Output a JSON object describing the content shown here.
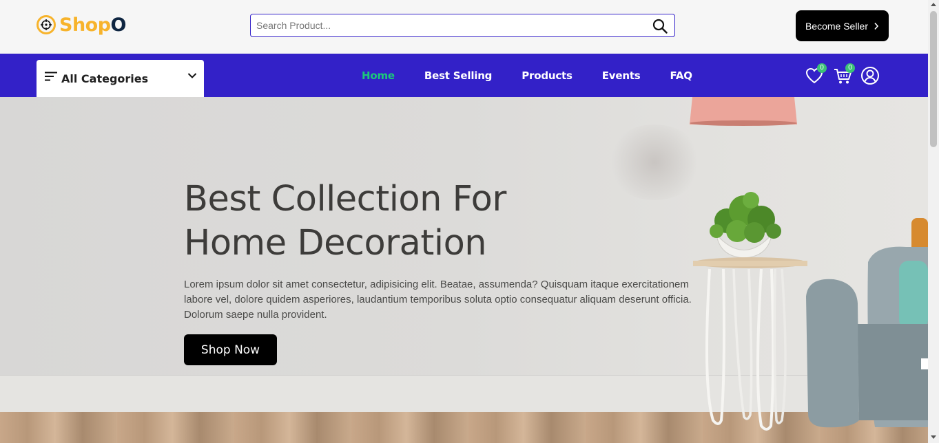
{
  "header": {
    "logo": {
      "part1": "Shop",
      "part2": "O"
    },
    "search": {
      "placeholder": "Search Product..."
    },
    "seller_button": "Become Seller"
  },
  "nav": {
    "categories_label": "All Categories",
    "links": [
      {
        "label": "Home",
        "active": true
      },
      {
        "label": "Best Selling",
        "active": false
      },
      {
        "label": "Products",
        "active": false
      },
      {
        "label": "Events",
        "active": false
      },
      {
        "label": "FAQ",
        "active": false
      }
    ],
    "wishlist_count": "0",
    "cart_count": "0"
  },
  "hero": {
    "title_line1": "Best Collection For",
    "title_line2": "Home Decoration",
    "description": "Lorem ipsum dolor sit amet consectetur, adipisicing elit. Beatae, assumenda? Quisquam itaque exercitationem labore vel, dolore quidem asperiores, laudantium temporibus soluta optio consequatur aliquam deserunt officia. Dolorum saepe nulla provident.",
    "button": "Shop Now"
  },
  "colors": {
    "brand": "#f7b32b",
    "nav_bg": "#3321c8",
    "active_link": "#1bc97a",
    "badge": "#3bc177"
  },
  "icons": [
    "logo-target-icon",
    "search-icon",
    "chevron-right-icon",
    "menu-lines-icon",
    "chevron-down-icon",
    "heart-icon",
    "cart-icon",
    "user-icon"
  ]
}
